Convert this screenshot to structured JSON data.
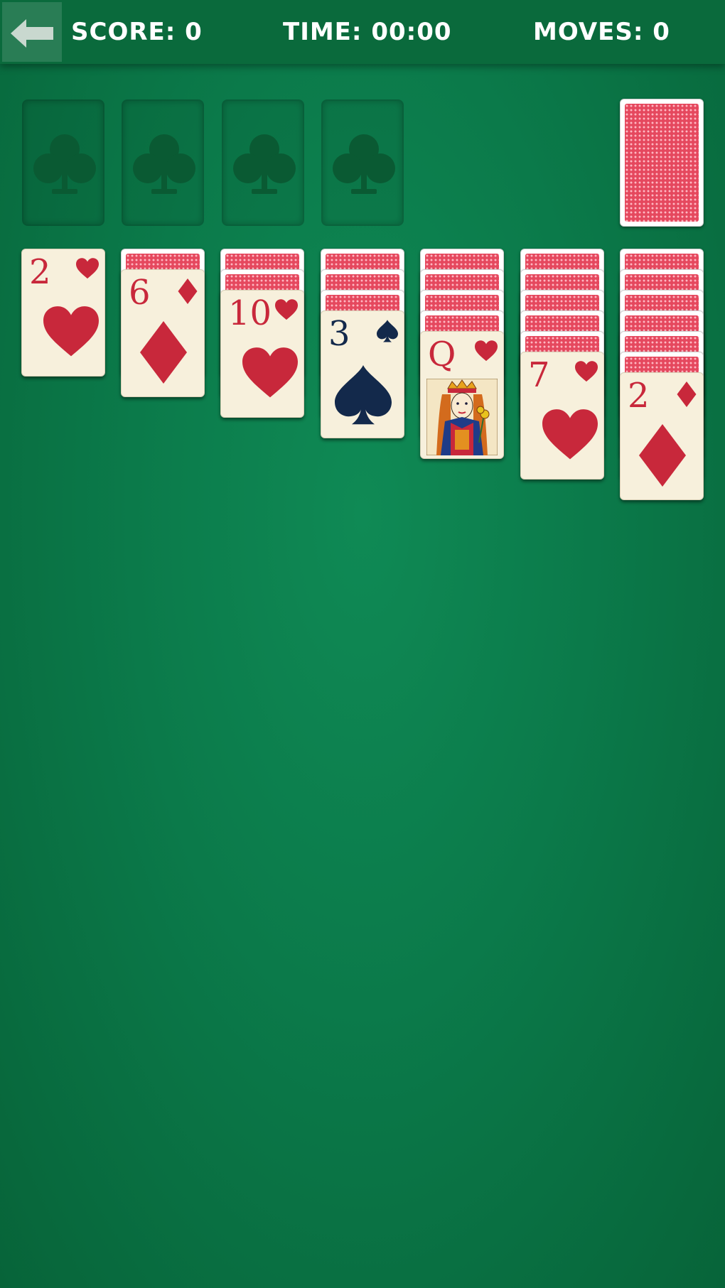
{
  "header": {
    "back_icon": "back-arrow-icon",
    "score_text": "SCORE: 0",
    "time_text": "TIME: 00:00",
    "moves_text": "MOVES: 0"
  },
  "foundations": [
    {
      "icon": "club-icon"
    },
    {
      "icon": "club-icon"
    },
    {
      "icon": "club-icon"
    },
    {
      "icon": "club-icon"
    }
  ],
  "stock": {
    "icon": "card-back"
  },
  "tableau": [
    {
      "hidden": 0,
      "rank": "2",
      "suit": "hearts",
      "color": "red"
    },
    {
      "hidden": 1,
      "rank": "6",
      "suit": "diamonds",
      "color": "red"
    },
    {
      "hidden": 2,
      "rank": "10",
      "suit": "hearts",
      "color": "red"
    },
    {
      "hidden": 3,
      "rank": "3",
      "suit": "spades",
      "color": "black"
    },
    {
      "hidden": 4,
      "rank": "Q",
      "suit": "hearts",
      "color": "red"
    },
    {
      "hidden": 5,
      "rank": "7",
      "suit": "hearts",
      "color": "red"
    },
    {
      "hidden": 6,
      "rank": "2",
      "suit": "diamonds",
      "color": "red"
    }
  ],
  "colors": {
    "felt": "#0b7a4a",
    "red_suit": "#c8283b",
    "black_suit": "#13294b",
    "card_face": "#f7f0dc",
    "card_back": "#e5485e"
  }
}
